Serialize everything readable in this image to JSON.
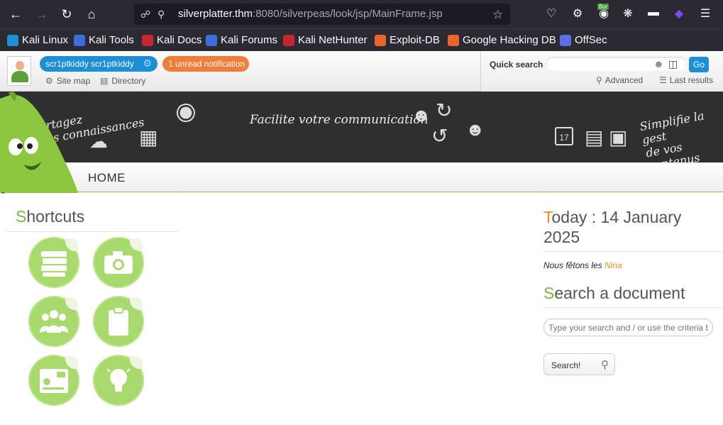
{
  "browser": {
    "url_host": "silverplatter.thm",
    "url_path": ":8080/silverpeas/look/jsp/MainFrame.jsp",
    "bookmarks": [
      {
        "label": "Kali Linux",
        "color": "#1f8fd6"
      },
      {
        "label": "Kali Tools",
        "color": "#3d6cdb"
      },
      {
        "label": "Kali Docs",
        "color": "#c6262e"
      },
      {
        "label": "Kali Forums",
        "color": "#3d6cdb"
      },
      {
        "label": "Kali NetHunter",
        "color": "#c6262e"
      },
      {
        "label": "Exploit-DB",
        "color": "#e8662a"
      },
      {
        "label": "Google Hacking DB",
        "color": "#e8662a"
      },
      {
        "label": "OffSec",
        "color": "#5b6ee8"
      }
    ],
    "extension_badge": "Bur"
  },
  "header": {
    "user_label": "scr1ptkiddy scr1ptkiddy",
    "notification_label": "1 unread notification",
    "site_map_label": "Site map",
    "directory_label": "Directory"
  },
  "quick_search": {
    "label": "Quick search",
    "go_label": "Go",
    "advanced_label": "Advanced",
    "last_results_label": "Last results"
  },
  "banner": {
    "share_line1": "Partagez",
    "share_line2": "vos connaissances",
    "communication": "Facilite votre communication",
    "simplify_line1": "Simplifie la gest",
    "simplify_line2": "de vos contenus",
    "calendar_day": "17"
  },
  "menu": {
    "home_label": "HOME"
  },
  "shortcuts": {
    "title_first": "S",
    "title_rest": "hortcuts",
    "items": [
      "books-icon",
      "camera-icon",
      "people-icon",
      "clipboard-icon",
      "map-icon",
      "lightbulb-icon"
    ]
  },
  "today": {
    "title_first": "T",
    "title_rest": "oday : 14 January",
    "title_line2": "2025",
    "feast_prefix": "Nous fêtons les",
    "feast_name": "Nina"
  },
  "doc_search": {
    "title_first": "S",
    "title_rest": "earch a document",
    "placeholder": "Type your search and / or use the criteria b",
    "button_label": "Search!"
  },
  "colors": {
    "accent_green": "#7db543",
    "accent_orange": "#f08c1e",
    "brand_blue": "#1d8fd8"
  }
}
